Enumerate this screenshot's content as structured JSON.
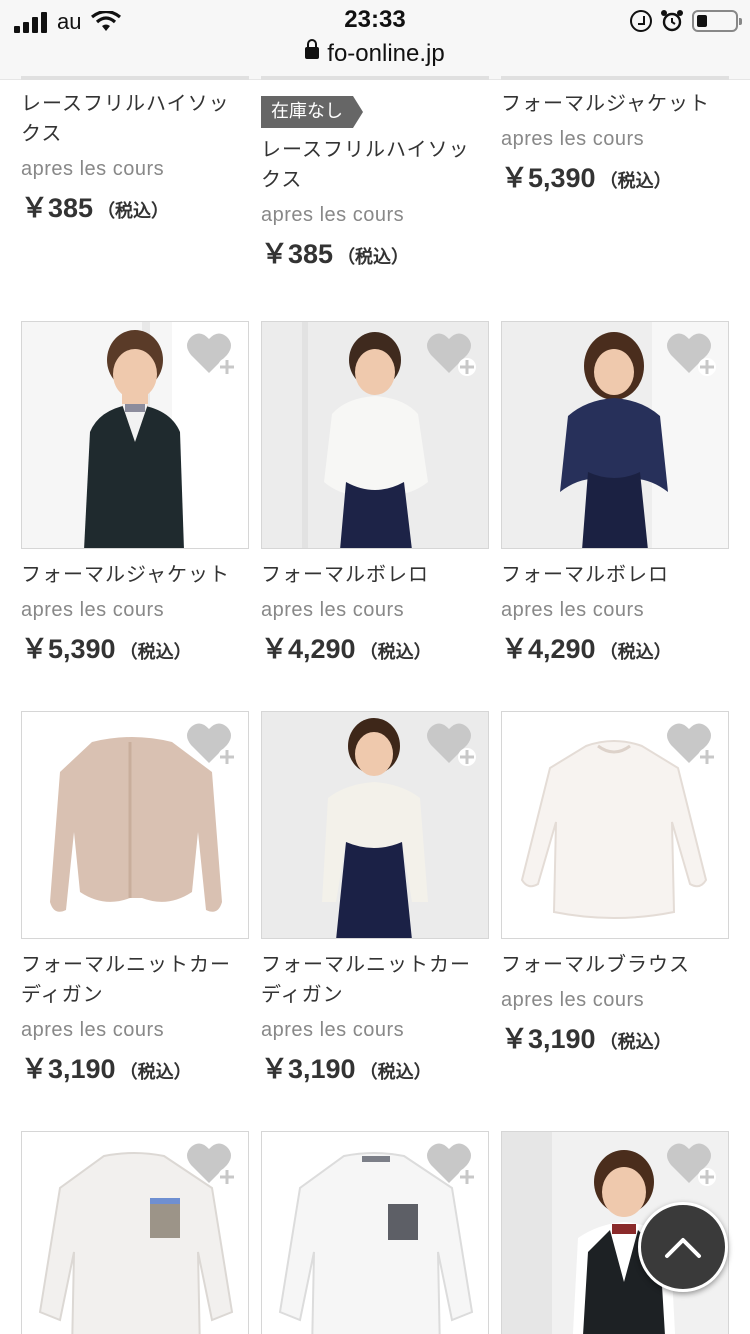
{
  "status_bar": {
    "carrier": "au",
    "time": "23:33",
    "url": "fo-online.jp"
  },
  "products": [
    {
      "name": "レースフリルハイソックス",
      "brand": "apres les cours",
      "price": "￥385",
      "tax": "（税込）",
      "badge": ""
    },
    {
      "name": "レースフリルハイソックス",
      "brand": "apres les cours",
      "price": "￥385",
      "tax": "（税込）",
      "badge": "在庫なし"
    },
    {
      "name": "フォーマルジャケット",
      "brand": "apres les cours",
      "price": "￥5,390",
      "tax": "（税込）",
      "badge": ""
    },
    {
      "name": "フォーマルジャケット",
      "brand": "apres les cours",
      "price": "￥5,390",
      "tax": "（税込）",
      "image": "boy in black formal jacket"
    },
    {
      "name": "フォーマルボレロ",
      "brand": "apres les cours",
      "price": "￥4,290",
      "tax": "（税込）",
      "image": "girl in white bolero"
    },
    {
      "name": "フォーマルボレロ",
      "brand": "apres les cours",
      "price": "￥4,290",
      "tax": "（税込）",
      "image": "girl in navy bolero"
    },
    {
      "name": "フォーマルニットカーディガン",
      "brand": "apres les cours",
      "price": "￥3,190",
      "tax": "（税込）",
      "image": "pink knit cardigan"
    },
    {
      "name": "フォーマルニットカーディガン",
      "brand": "apres les cours",
      "price": "￥3,190",
      "tax": "（税込）",
      "image": "girl in white knit cardigan"
    },
    {
      "name": "フォーマルブラウス",
      "brand": "apres les cours",
      "price": "￥3,190",
      "tax": "（税込）",
      "image": "white blouse"
    },
    {
      "image": "white dotted shirt"
    },
    {
      "image": "white shirt with check pocket"
    },
    {
      "image": "boy in black vest"
    }
  ],
  "icons": {
    "favorite": "heart-plus-icon",
    "scroll_top": "chevron-up-icon"
  },
  "colors": {
    "heart": "#c8c8c8",
    "badge_bg": "#666666",
    "scroll_btn": "#3a3a3a"
  }
}
